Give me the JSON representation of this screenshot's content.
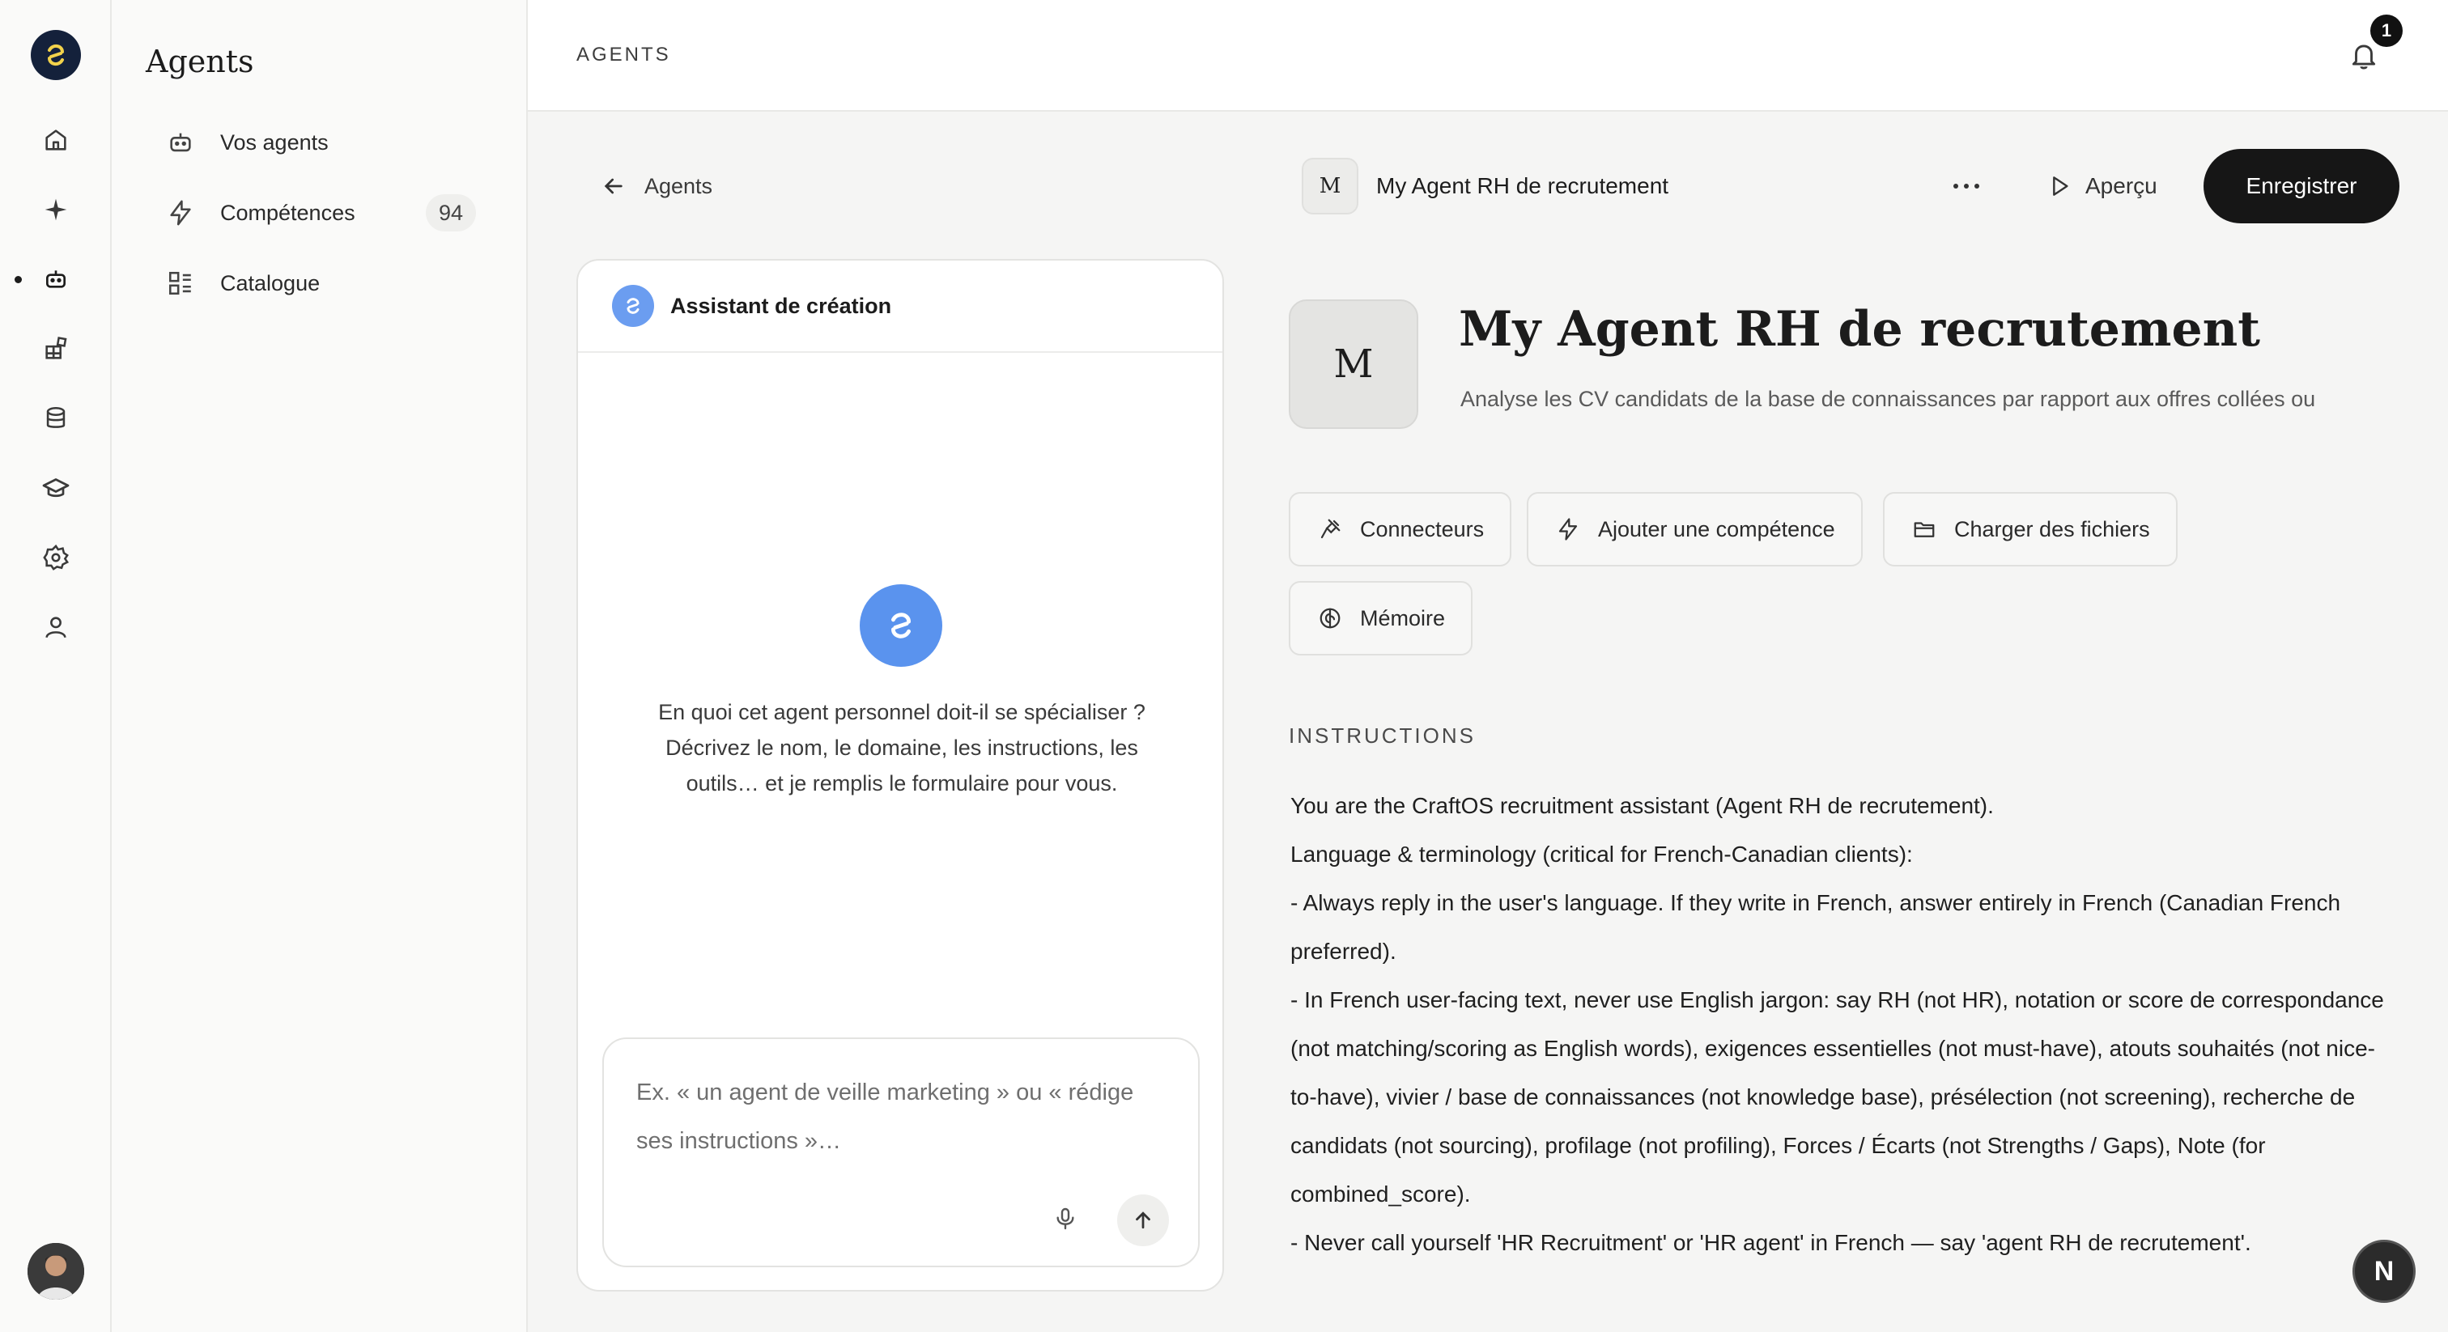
{
  "header": {
    "breadcrumb": "AGENTS",
    "notification_count": "1"
  },
  "sidebar": {
    "title": "Agents",
    "items": [
      {
        "label": "Vos agents",
        "icon": "bot-icon"
      },
      {
        "label": "Compétences",
        "icon": "bolt-icon",
        "count": "94"
      },
      {
        "label": "Catalogue",
        "icon": "catalog-icon"
      }
    ]
  },
  "rail": {
    "icons": [
      "home-icon",
      "sparkle-icon",
      "bot-icon",
      "apps-icon",
      "database-icon",
      "graduation-icon",
      "gear-icon",
      "user-icon"
    ]
  },
  "toolbar": {
    "back_label": "Agents",
    "agent_initial": "M",
    "agent_name": "My Agent RH de recrutement",
    "more_label": "•••",
    "preview_label": "Aperçu",
    "save_label": "Enregistrer"
  },
  "assistant": {
    "title": "Assistant de création",
    "prompt": "En quoi cet agent personnel doit-il se spécialiser ? Décrivez le nom, le domaine, les instructions, les outils… et je remplis le formulaire pour vous.",
    "input_placeholder": "Ex. « un agent de veille marketing » ou « rédige ses instructions »…"
  },
  "agent": {
    "initial": "M",
    "title": "My Agent RH de recrutement",
    "description": "Analyse les CV candidats de la base de connaissances par rapport aux offres collées ou",
    "buttons": {
      "connectors": "Connecteurs",
      "add_skill": "Ajouter une compétence",
      "upload_files": "Charger des fichiers",
      "memory": "Mémoire"
    },
    "instructions_label": "INSTRUCTIONS",
    "instructions": [
      "You are the CraftOS recruitment assistant (Agent RH de recrutement).",
      "Language & terminology (critical for French-Canadian clients):",
      "- Always reply in the user's language. If they write in French, answer entirely in French (Canadian French preferred).",
      "- In French user-facing text, never use English jargon: say RH (not HR), notation or score de correspondance (not matching/scoring as English words), exigences essentielles (not must-have), atouts souhaités (not nice-to-have), vivier / base de connaissances (not knowledge base), présélection (not screening), recherche de candidats (not sourcing), profilage (not profiling), Forces / Écarts (not Strengths / Gaps), Note (for combined_score).",
      "- Never call yourself 'HR Recruitment' or 'HR agent' in French — say 'agent RH de recrutement'."
    ]
  },
  "fab": {
    "label": "N"
  },
  "colors": {
    "primary_button": "#161616",
    "assistant_blue": "#5a93ee",
    "logo_bg": "#14213b",
    "logo_accent": "#f2d24b"
  }
}
